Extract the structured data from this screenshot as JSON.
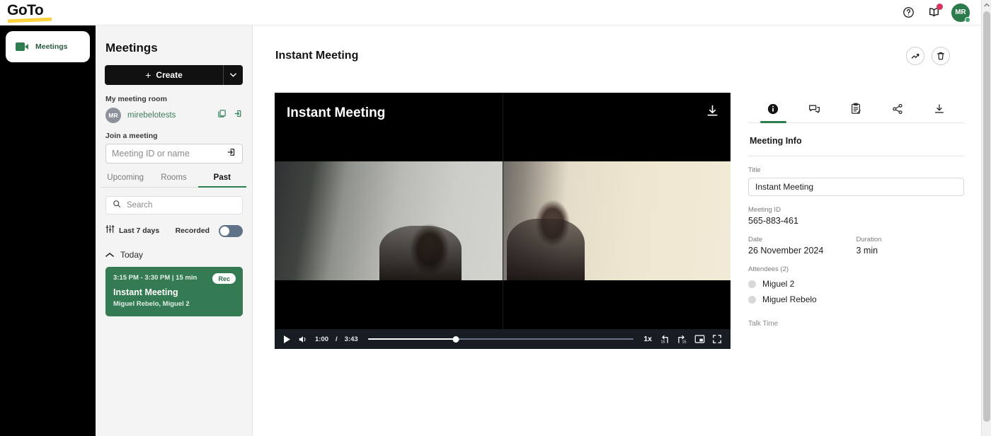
{
  "brand": {
    "logo_text": "GoTo",
    "accent_yellow": "#ffd23f",
    "accent_green": "#2e7d4f"
  },
  "topbar": {
    "help_icon": "question-circle-icon",
    "training_icon": "open-book-icon",
    "avatar_initials": "MR"
  },
  "rail": {
    "items": [
      {
        "label": "Meetings",
        "icon": "video-camera-icon",
        "active": true
      }
    ]
  },
  "panel": {
    "title": "Meetings",
    "create_label": "Create",
    "create_plus": "+",
    "create_caret": "chevron-down-icon",
    "my_room_label": "My meeting room",
    "room_avatar_initials": "MR",
    "room_name": "mirebelotests",
    "copy_icon": "copy-icon",
    "enter_room_icon": "enter-arrow-icon",
    "join_label": "Join a meeting",
    "join_placeholder": "Meeting ID or name",
    "join_value": "",
    "join_submit_icon": "enter-arrow-icon",
    "tabs": [
      {
        "label": "Upcoming",
        "active": false
      },
      {
        "label": "Rooms",
        "active": false
      },
      {
        "label": "Past",
        "active": true
      }
    ],
    "search_placeholder": "Search",
    "search_value": "",
    "filter_label": "Last 7 days",
    "filter_icon": "sliders-icon",
    "recorded_label": "Recorded",
    "recorded_on": false,
    "group_label": "Today",
    "group_chevron": "chevron-up-icon",
    "meeting": {
      "time_range": "3:15 PM  -  3:30 PM  |  15 min",
      "title": "Instant Meeting",
      "participants": "Miguel Rebelo, Miguel 2",
      "badge": "Rec"
    }
  },
  "main": {
    "title": "Instant Meeting",
    "analytics_icon": "trend-arrow-icon",
    "delete_icon": "trash-icon"
  },
  "player": {
    "overlay_title": "Instant Meeting",
    "download_icon": "download-icon",
    "play_icon": "play-icon",
    "volume_icon": "volume-icon",
    "current_time": "1:00",
    "separator": "/",
    "total_time": "3:43",
    "progress_percent": 33,
    "speed": "1x",
    "rewind_icon": "rewind-15-icon",
    "forward_icon": "forward-15-icon",
    "pip_icon": "picture-in-picture-icon",
    "fullscreen_icon": "fullscreen-icon"
  },
  "info": {
    "tabs": [
      {
        "name": "info-tab",
        "icon": "info-circle-icon",
        "active": true
      },
      {
        "name": "chat-tab",
        "icon": "chat-bubbles-icon",
        "active": false
      },
      {
        "name": "notes-tab",
        "icon": "notes-clipboard-icon",
        "active": false
      },
      {
        "name": "share-tab",
        "icon": "share-icon",
        "active": false
      },
      {
        "name": "download-tab",
        "icon": "download-icon",
        "active": false
      }
    ],
    "heading": "Meeting Info",
    "title_label": "Title",
    "title_value": "Instant Meeting",
    "meeting_id_label": "Meeting ID",
    "meeting_id_value": "565-883-461",
    "date_label": "Date",
    "date_value": "26 November 2024",
    "duration_label": "Duration",
    "duration_value": "3 min",
    "attendees_label": "Attendees (2)",
    "attendees": [
      {
        "name": "Miguel 2"
      },
      {
        "name": "Miguel Rebelo"
      }
    ],
    "talk_time_label": "Talk Time"
  },
  "scrollbar": {
    "up_arrow": "caret-up-icon"
  }
}
